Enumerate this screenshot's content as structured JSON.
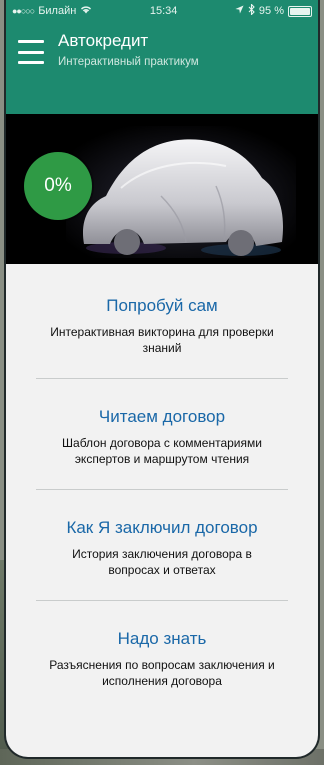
{
  "status_bar": {
    "carrier": "Билайн",
    "time": "15:34",
    "battery": "95 %",
    "battery_level": 0.95
  },
  "header": {
    "title": "Автокредит",
    "subtitle": "Интерактивный практикум"
  },
  "hero": {
    "progress_label": "0%",
    "progress": 0,
    "accent": "#2f9a45"
  },
  "items": [
    {
      "title": "Попробуй сам",
      "description": "Интерактивная викторина для проверки знаний"
    },
    {
      "title": "Читаем договор",
      "description": "Шаблон договора с комментариями экспертов и маршрутом чтения"
    },
    {
      "title": "Как Я заключил договор",
      "description": "История заключения договора в вопросах и ответах"
    },
    {
      "title": "Надо знать",
      "description": "Разъяснения по вопросам заключения и исполнения договора"
    }
  ],
  "colors": {
    "brand": "#1d8a6f",
    "link": "#1a68a8",
    "background": "#f2f2f2"
  },
  "icons": {
    "menu": "hamburger-icon",
    "wifi": "wifi-icon",
    "location": "location-arrow-icon",
    "bluetooth": "bluetooth-icon",
    "battery": "battery-icon"
  }
}
